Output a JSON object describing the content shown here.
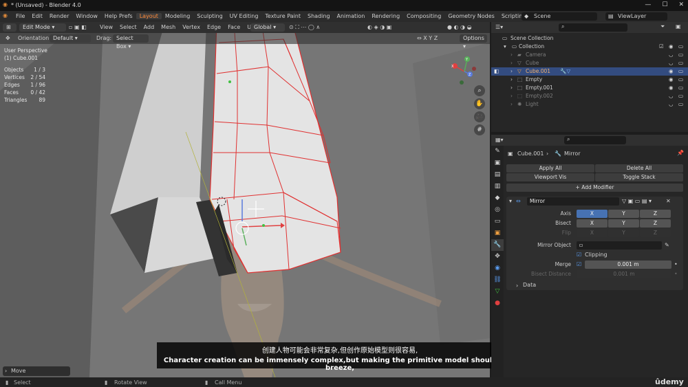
{
  "window": {
    "title": "* (Unsaved) - Blender 4.0"
  },
  "menu": [
    "File",
    "Edit",
    "Render",
    "Window",
    "Help"
  ],
  "workspaces": [
    "Prefs",
    "Layout",
    "Modeling",
    "Sculpting",
    "UV Editing",
    "Texture Paint",
    "Shading",
    "Animation",
    "Rendering",
    "Compositing",
    "Geometry Nodes",
    "Scripting"
  ],
  "active_workspace_index": 1,
  "scene": "Scene",
  "view_layer": "ViewLayer",
  "viewport": {
    "mode": "Edit Mode",
    "menus": [
      "View",
      "Select",
      "Add",
      "Mesh",
      "Vertex",
      "Edge",
      "Face",
      "UV"
    ],
    "transform": "Global",
    "orientation_label": "Orientation:",
    "orientation_value": "Default",
    "drag_label": "Drag:",
    "drag_value": "Select Box",
    "options": "Options",
    "xyz": [
      "X",
      "Y",
      "Z"
    ],
    "view_name": "User Perspective",
    "object_name": "(1) Cube.001",
    "stats": [
      {
        "label": "Objects",
        "value": "1 / 3"
      },
      {
        "label": "Vertices",
        "value": "2 / 54"
      },
      {
        "label": "Edges",
        "value": "1 / 96"
      },
      {
        "label": "Faces",
        "value": "0 / 42"
      },
      {
        "label": "Triangles",
        "value": "89"
      }
    ],
    "gizmo": {
      "x": "X",
      "y": "Y",
      "z": "Z"
    },
    "last_op": "Move"
  },
  "subtitle": {
    "zh": "创建人物可能会非常复杂,但创作原始模型则很容易,",
    "en": "Character creation can be immensely complex,but making the primitive model should be a breeze,"
  },
  "statusbar": [
    "Select",
    "Rotate View",
    "Call Menu"
  ],
  "watermark": "ûdemy",
  "outliner": {
    "items": [
      {
        "name": "Scene Collection",
        "indent": 0,
        "dim": false,
        "selected": false
      },
      {
        "name": "Collection",
        "indent": 1,
        "dim": false,
        "selected": false
      },
      {
        "name": "Camera",
        "indent": 2,
        "dim": true,
        "selected": false
      },
      {
        "name": "Cube",
        "indent": 2,
        "dim": true,
        "selected": false
      },
      {
        "name": "Cube.001",
        "indent": 2,
        "dim": false,
        "selected": true
      },
      {
        "name": "Empty",
        "indent": 2,
        "dim": false,
        "selected": false
      },
      {
        "name": "Empty.001",
        "indent": 2,
        "dim": false,
        "selected": false
      },
      {
        "name": "Empty.002",
        "indent": 2,
        "dim": true,
        "selected": false
      },
      {
        "name": "Light",
        "indent": 2,
        "dim": true,
        "selected": false
      }
    ]
  },
  "properties": {
    "object": "Cube.001",
    "modifier_tab": "Mirror",
    "apply_all": "Apply All",
    "delete_all": "Delete All",
    "viewport_vis": "Viewport Vis",
    "toggle_stack": "Toggle Stack",
    "add_modifier": "Add Modifier",
    "modifier_name": "Mirror",
    "axis_label": "Axis",
    "bisect_label": "Bisect",
    "flip_label": "Flip",
    "axes": [
      "X",
      "Y",
      "Z"
    ],
    "mirror_object_label": "Mirror Object",
    "clipping_label": "Clipping",
    "merge_label": "Merge",
    "merge_value": "0.001 m",
    "bisect_distance_label": "Bisect Distance",
    "bisect_distance_value": "0.001 m",
    "data_label": "Data"
  }
}
